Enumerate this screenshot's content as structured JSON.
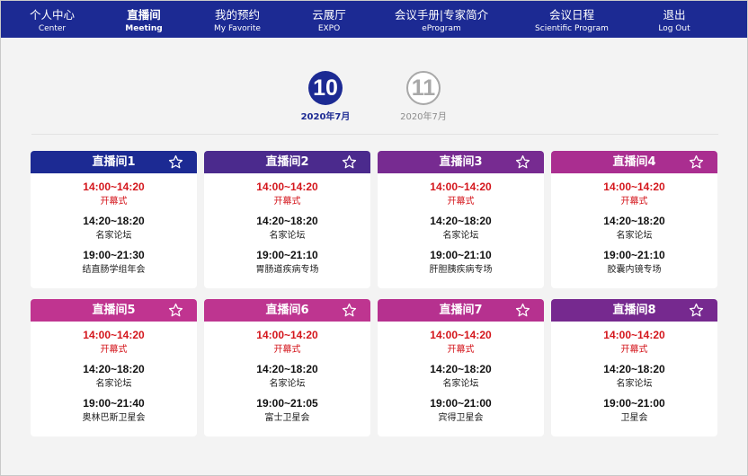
{
  "nav": [
    {
      "zh": "个人中心",
      "en": "Center",
      "active": false
    },
    {
      "zh": "直播间",
      "en": "Meeting",
      "active": true
    },
    {
      "zh": "我的预约",
      "en": "My Favorite",
      "active": false
    },
    {
      "zh": "云展厅",
      "en": "EXPO",
      "active": false
    },
    {
      "zh": "会议手册|专家简介",
      "en": "eProgram",
      "active": false
    },
    {
      "zh": "会议日程",
      "en": "Scientific Program",
      "active": false
    },
    {
      "zh": "退出",
      "en": "Log Out",
      "active": false
    }
  ],
  "dates": [
    {
      "day": "10",
      "month": "2020年7月",
      "active": true
    },
    {
      "day": "11",
      "month": "2020年7月",
      "active": false
    }
  ],
  "rooms": [
    {
      "title": "直播间1",
      "color": "#1c2a93",
      "sessions": [
        {
          "time": "14:00~14:20",
          "name": "开幕式",
          "live": true
        },
        {
          "time": "14:20~18:20",
          "name": "名家论坛",
          "live": false
        },
        {
          "time": "19:00~21:30",
          "name": "结直肠学组年会",
          "live": false
        }
      ]
    },
    {
      "title": "直播间2",
      "color": "#4b2a8d",
      "sessions": [
        {
          "time": "14:00~14:20",
          "name": "开幕式",
          "live": true
        },
        {
          "time": "14:20~18:20",
          "name": "名家论坛",
          "live": false
        },
        {
          "time": "19:00~21:10",
          "name": "胃肠道疾病专场",
          "live": false
        }
      ]
    },
    {
      "title": "直播间3",
      "color": "#772b91",
      "sessions": [
        {
          "time": "14:00~14:20",
          "name": "开幕式",
          "live": true
        },
        {
          "time": "14:20~18:20",
          "name": "名家论坛",
          "live": false
        },
        {
          "time": "19:00~21:10",
          "name": "肝胆胰疾病专场",
          "live": false
        }
      ]
    },
    {
      "title": "直播间4",
      "color": "#aa2e90",
      "sessions": [
        {
          "time": "14:00~14:20",
          "name": "开幕式",
          "live": true
        },
        {
          "time": "14:20~18:20",
          "name": "名家论坛",
          "live": false
        },
        {
          "time": "19:00~21:10",
          "name": "胶囊内镜专场",
          "live": false
        }
      ]
    },
    {
      "title": "直播间5",
      "color": "#c03490",
      "sessions": [
        {
          "time": "14:00~14:20",
          "name": "开幕式",
          "live": true
        },
        {
          "time": "14:20~18:20",
          "name": "名家论坛",
          "live": false
        },
        {
          "time": "19:00~21:40",
          "name": "奥林巴斯卫星会",
          "live": false
        }
      ]
    },
    {
      "title": "直播间6",
      "color": "#be3590",
      "sessions": [
        {
          "time": "14:00~14:20",
          "name": "开幕式",
          "live": true
        },
        {
          "time": "14:20~18:20",
          "name": "名家论坛",
          "live": false
        },
        {
          "time": "19:00~21:05",
          "name": "富士卫星会",
          "live": false
        }
      ]
    },
    {
      "title": "直播间7",
      "color": "#b6318f",
      "sessions": [
        {
          "time": "14:00~14:20",
          "name": "开幕式",
          "live": true
        },
        {
          "time": "14:20~18:20",
          "name": "名家论坛",
          "live": false
        },
        {
          "time": "19:00~21:00",
          "name": "宾得卫星会",
          "live": false
        }
      ]
    },
    {
      "title": "直播间8",
      "color": "#76298f",
      "sessions": [
        {
          "time": "14:00~14:20",
          "name": "开幕式",
          "live": true
        },
        {
          "time": "14:20~18:20",
          "name": "名家论坛",
          "live": false
        },
        {
          "time": "19:00~21:00",
          "name": "卫星会",
          "live": false
        }
      ]
    }
  ]
}
